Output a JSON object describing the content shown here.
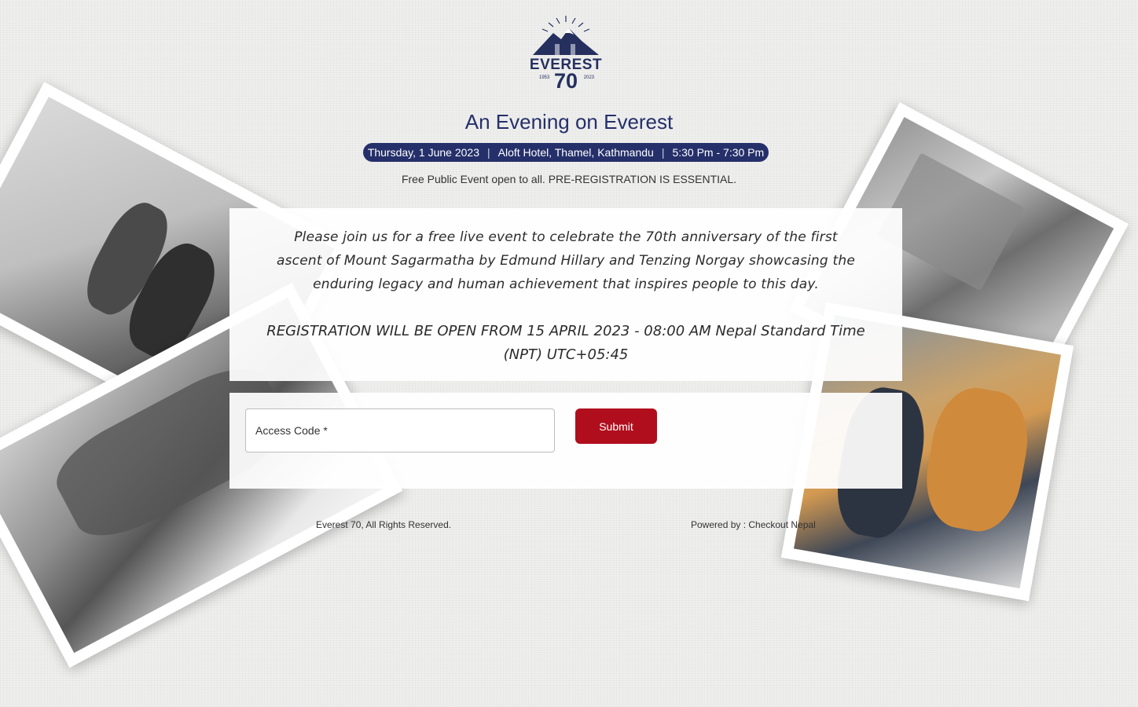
{
  "logo": {
    "word": "EVEREST",
    "number": "70",
    "year_start": "1953",
    "year_end": "2023"
  },
  "event": {
    "title": "An Evening on Everest",
    "date": "Thursday, 1 June 2023",
    "venue": "Aloft Hotel, Thamel, Kathmandu",
    "time": "5:30 Pm - 7:30 Pm",
    "separator": "|",
    "notice": "Free Public Event open to all. PRE-REGISTRATION IS ESSENTIAL."
  },
  "message": {
    "body": "Please join us for a free live event to celebrate the 70th anniversary of the first ascent of Mount Sagarmatha by Edmund Hillary and Tenzing Norgay showcasing the enduring legacy and human achievement that inspires people to this day.",
    "registration": "REGISTRATION WILL BE OPEN FROM 15 APRIL 2023 - 08:00 AM  Nepal Standard Time (NPT) UTC+05:45"
  },
  "form": {
    "access_code_label": "Access Code *",
    "submit_label": "Submit"
  },
  "footer": {
    "rights": "Everest 70, All Rights Reserved.",
    "powered_by": "Powered by : Checkout Nepal"
  },
  "colors": {
    "primary": "#25306a",
    "submit": "#b10e1d"
  }
}
